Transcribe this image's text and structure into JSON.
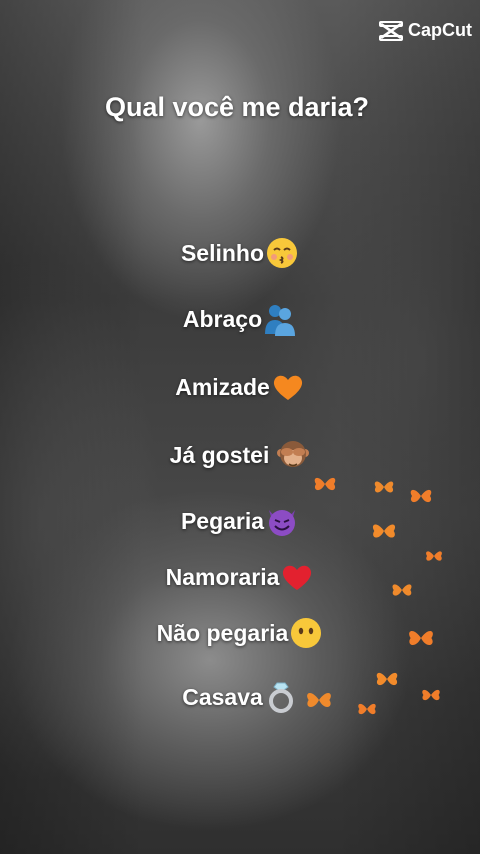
{
  "watermark": {
    "brand": "CapCut",
    "icon": "capcut-logo-icon"
  },
  "title": "Qual você me daria?",
  "options": [
    {
      "label": "Selinho",
      "emoji": "kissing-face-icon"
    },
    {
      "label": "Abraço",
      "emoji": "hugging-people-icon"
    },
    {
      "label": "Amizade",
      "emoji": "orange-heart-icon"
    },
    {
      "label": "Já gostei",
      "emoji": "see-no-evil-monkey-icon"
    },
    {
      "label": "Pegaria",
      "emoji": "smiling-devil-icon"
    },
    {
      "label": "Namoraria",
      "emoji": "red-heart-icon"
    },
    {
      "label": "Não pegaria",
      "emoji": "face-without-mouth-icon"
    },
    {
      "label": "Casava",
      "emoji": "ring-icon"
    }
  ],
  "colors": {
    "text": "#ffffff",
    "butterfly": "#f07d2a"
  }
}
